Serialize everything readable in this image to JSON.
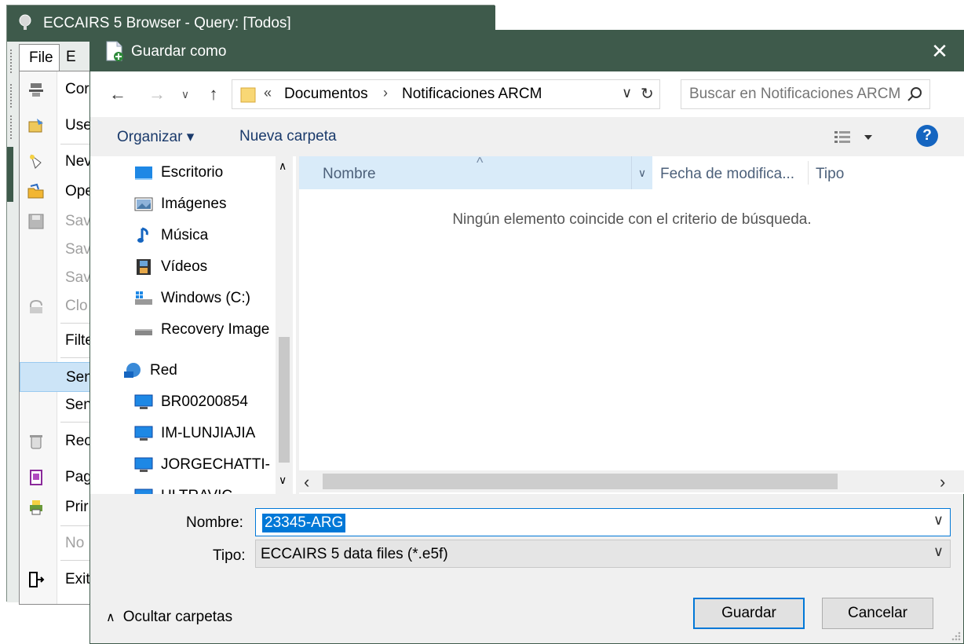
{
  "background_window": {
    "title": "ECCAIRS 5 Browser - Query: [Todos]",
    "menubar": {
      "file": "File",
      "edit_partial": "E"
    },
    "file_menu": [
      {
        "label": "Cor",
        "icon": "connect-icon",
        "disabled": false
      },
      {
        "label": "Use",
        "icon": "user-icon",
        "disabled": false
      },
      {
        "label": "Nev",
        "icon": "new-icon",
        "disabled": false
      },
      {
        "label": "Ope",
        "icon": "open-folder-icon",
        "disabled": false
      },
      {
        "label": "Sav",
        "icon": "save-icon",
        "disabled": true
      },
      {
        "label": "Sav",
        "icon": "",
        "disabled": true
      },
      {
        "label": "Sav",
        "icon": "",
        "disabled": true
      },
      {
        "label": "Clo",
        "icon": "close-doc-icon",
        "disabled": true
      },
      {
        "label": "Filte",
        "icon": "",
        "disabled": false
      },
      {
        "label": "Sen",
        "icon": "",
        "disabled": false,
        "highlighted": true
      },
      {
        "label": "Sen",
        "icon": "",
        "disabled": false
      },
      {
        "label": "Rec",
        "icon": "recycle-icon",
        "disabled": false
      },
      {
        "label": "Pag",
        "icon": "page-setup-icon",
        "disabled": false
      },
      {
        "label": "Prir",
        "icon": "print-icon",
        "disabled": false
      },
      {
        "label": "No",
        "icon": "",
        "disabled": true
      },
      {
        "label": "Exit",
        "icon": "exit-icon",
        "disabled": false
      }
    ]
  },
  "dialog": {
    "title": "Guardar como",
    "close": "✕",
    "breadcrumb": {
      "prefix": "«",
      "items": [
        "Documentos",
        "Notificaciones ARCM"
      ]
    },
    "search_placeholder": "Buscar en Notificaciones ARCM",
    "toolbar": {
      "organize": "Organizar ▾",
      "new_folder": "Nueva carpeta",
      "help": "?"
    },
    "nav_items": [
      {
        "label": "Escritorio",
        "icon": "desktop-icon"
      },
      {
        "label": "Imágenes",
        "icon": "pictures-icon"
      },
      {
        "label": "Música",
        "icon": "music-icon"
      },
      {
        "label": "Vídeos",
        "icon": "videos-icon"
      },
      {
        "label": "Windows (C:)",
        "icon": "drive-icon"
      },
      {
        "label": "Recovery Image",
        "icon": "drive-icon"
      },
      {
        "label": "Red",
        "icon": "network-icon"
      },
      {
        "label": "BR00200854",
        "icon": "computer-icon"
      },
      {
        "label": "IM-LUNJIAJIA",
        "icon": "computer-icon"
      },
      {
        "label": "JORGECHATTI-H",
        "icon": "computer-icon"
      },
      {
        "label": "ULTRAVIC",
        "icon": "computer-icon"
      }
    ],
    "columns": {
      "name": "Nombre",
      "date": "Fecha de modifica...",
      "type": "Tipo"
    },
    "empty_message": "Ningún elemento coincide con el criterio de búsqueda.",
    "filename_label": "Nombre:",
    "filename_value": "23345-ARG",
    "filetype_label": "Tipo:",
    "filetype_value": "ECCAIRS 5 data files (*.e5f)",
    "hide_folders": "Ocultar carpetas",
    "save_button": "Guardar",
    "cancel_button": "Cancelar"
  },
  "colors": {
    "titlebar": "#3e5a4b",
    "accent": "#0078d7",
    "link": "#1a3a6b"
  }
}
